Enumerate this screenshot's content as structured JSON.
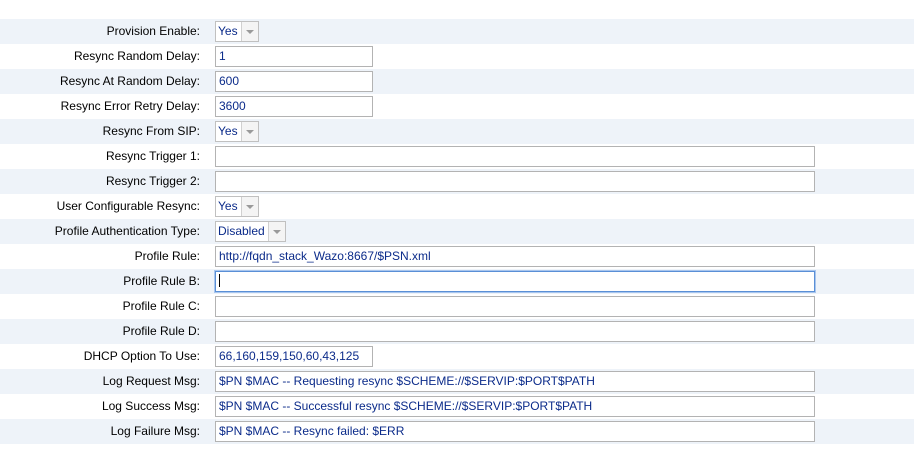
{
  "rows": [
    {
      "label": "Provision Enable:",
      "type": "select",
      "value": "Yes"
    },
    {
      "label": "Resync Random Delay:",
      "type": "text",
      "size": "short",
      "value": "1"
    },
    {
      "label": "Resync At Random Delay:",
      "type": "text",
      "size": "short",
      "value": "600"
    },
    {
      "label": "Resync Error Retry Delay:",
      "type": "text",
      "size": "short",
      "value": "3600"
    },
    {
      "label": "Resync From SIP:",
      "type": "select",
      "value": "Yes"
    },
    {
      "label": "Resync Trigger 1:",
      "type": "text",
      "size": "long",
      "value": ""
    },
    {
      "label": "Resync Trigger 2:",
      "type": "text",
      "size": "long",
      "value": ""
    },
    {
      "label": "User Configurable Resync:",
      "type": "select",
      "value": "Yes"
    },
    {
      "label": "Profile Authentication Type:",
      "type": "select",
      "value": "Disabled"
    },
    {
      "label": "Profile Rule:",
      "type": "text",
      "size": "long",
      "value": "http://fqdn_stack_Wazo:8667/$PSN.xml"
    },
    {
      "label": "Profile Rule B:",
      "type": "text",
      "size": "long",
      "value": "",
      "focused": true
    },
    {
      "label": "Profile Rule C:",
      "type": "text",
      "size": "long",
      "value": ""
    },
    {
      "label": "Profile Rule D:",
      "type": "text",
      "size": "long",
      "value": ""
    },
    {
      "label": "DHCP Option To Use:",
      "type": "text",
      "size": "short",
      "value": "66,160,159,150,60,43,125"
    },
    {
      "label": "Log Request Msg:",
      "type": "text",
      "size": "long",
      "value": "$PN $MAC -- Requesting resync $SCHEME://$SERVIP:$PORT$PATH"
    },
    {
      "label": "Log Success Msg:",
      "type": "text",
      "size": "long",
      "value": "$PN $MAC -- Successful resync $SCHEME://$SERVIP:$PORT$PATH"
    },
    {
      "label": "Log Failure Msg:",
      "type": "text",
      "size": "long",
      "value": "$PN $MAC -- Resync failed: $ERR"
    }
  ],
  "colors": {
    "row_shade": "#eef3f9",
    "value_text": "#0b2b8a",
    "focus_border": "#5a8fd6"
  },
  "icons": {
    "select_arrow": "chevron-down-icon"
  }
}
